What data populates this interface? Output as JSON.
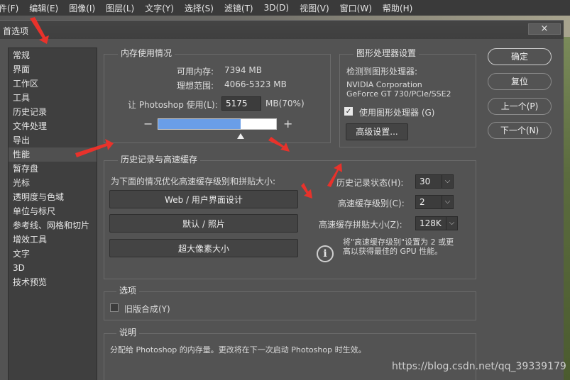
{
  "menu": [
    "件(F)",
    "编辑(E)",
    "图像(I)",
    "图层(L)",
    "文字(Y)",
    "选择(S)",
    "滤镜(T)",
    "3D(D)",
    "视图(V)",
    "窗口(W)",
    "帮助(H)"
  ],
  "dialog": {
    "title": "首选项",
    "close": "×"
  },
  "nav": {
    "active_index": 7,
    "items": [
      "常规",
      "界面",
      "工作区",
      "工具",
      "历史记录",
      "文件处理",
      "导出",
      "性能",
      "暂存盘",
      "光标",
      "透明度与色域",
      "单位与标尺",
      "参考线、网格和切片",
      "增效工具",
      "文字",
      "3D",
      "技术预览"
    ]
  },
  "memory": {
    "title": "内存使用情况",
    "available_label": "可用内存:",
    "available_value": "7394 MB",
    "ideal_label": "理想范围:",
    "ideal_value": "4066-5323 MB",
    "let_label": "让 Photoshop 使用(L):",
    "let_value": "5175",
    "unit": "MB(70%)",
    "minus": "−",
    "plus": "+",
    "usage_fraction": 0.7
  },
  "gpu": {
    "title": "图形处理器设置",
    "detected_label": "检测到图形处理器:",
    "vendor": "NVIDIA Corporation",
    "model": "GeForce GT 730/PCIe/SSE2",
    "use_label": "使用图形处理器 (G)",
    "use_checked": true,
    "check_mark": "✓",
    "advanced": "高级设置..."
  },
  "history_cache": {
    "title": "历史记录与高速缓存",
    "optimize_label": "为下面的情况优化高速缓存级别和拼贴大小:",
    "buttons": [
      "Web / 用户界面设计",
      "默认 / 照片",
      "超大像素大小"
    ],
    "history_states_label": "历史记录状态(H):",
    "history_states_value": "30",
    "cache_levels_label": "高速缓存级别(C):",
    "cache_levels_value": "2",
    "tile_size_label": "高速缓存拼贴大小(Z):",
    "tile_size_value": "128K",
    "info_line1": "将\"高速缓存级别\"设置为 2 或更",
    "info_line2": "高以获得最佳的 GPU 性能。",
    "info_icon_glyph": "i",
    "dropdown_glyph": "⌵"
  },
  "options": {
    "title": "选项",
    "legacy_label": "旧版合成(Y)",
    "legacy_checked": false
  },
  "description": {
    "title": "说明",
    "text": "分配给 Photoshop 的内存量。更改将在下一次启动 Photoshop 时生效。"
  },
  "side_buttons": [
    "确定",
    "复位",
    "上一个(P)",
    "下一个(N)"
  ],
  "watermark": "https://blog.csdn.net/qq_39339179",
  "colors": {
    "arrow": "#e8322b",
    "bar_fill": "#6a9ee8",
    "dialog_bg": "#535353"
  }
}
